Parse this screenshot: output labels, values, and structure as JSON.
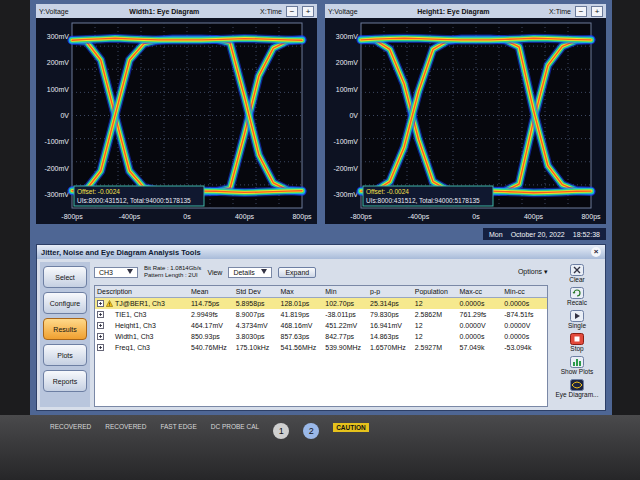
{
  "eye_plots": [
    {
      "title": "Width1: Eye Diagram",
      "y_axis_label": "Y:Voltage",
      "x_axis_label": "X:Time",
      "zoom_out": "−",
      "zoom_in": "+",
      "y_ticks": [
        "300mV",
        "200mV",
        "100mV",
        "0V",
        "-100mV",
        "-200mV",
        "-300mV"
      ],
      "x_ticks": [
        "-800ps",
        "-400ps",
        "0s",
        "400ps",
        "800ps"
      ],
      "offset": "Offset: -0.0024",
      "uis": "UIs:8000:431512, Total:94000:5178135",
      "time_ps": [
        -800,
        -700,
        -600,
        -500,
        -400,
        -300,
        -200,
        -100,
        0,
        100,
        200,
        300,
        400,
        500,
        600,
        700,
        800
      ],
      "traces": [
        [
          285,
          280,
          210,
          0,
          -210,
          -272,
          -285,
          -290,
          -290,
          -290,
          -288,
          -275,
          -70,
          150,
          255,
          282,
          288
        ],
        [
          -285,
          -280,
          -210,
          0,
          210,
          272,
          285,
          290,
          290,
          290,
          288,
          275,
          70,
          -150,
          -255,
          -282,
          -288
        ],
        [
          285,
          288,
          290,
          292,
          290,
          288,
          286,
          286,
          286,
          286,
          287,
          289,
          291,
          290,
          288,
          286,
          285
        ],
        [
          -285,
          -288,
          -290,
          -292,
          -290,
          -288,
          -286,
          -286,
          -286,
          -286,
          -287,
          -289,
          -291,
          -290,
          -288,
          -286,
          -285
        ]
      ]
    },
    {
      "title": "Height1: Eye Diagram",
      "y_axis_label": "Y:Voltage",
      "x_axis_label": "X:Time",
      "zoom_out": "−",
      "zoom_in": "+",
      "y_ticks": [
        "300mV",
        "200mV",
        "100mV",
        "0V",
        "-100mV",
        "-200mV",
        "-300mV"
      ],
      "x_ticks": [
        "-800ps",
        "-400ps",
        "0s",
        "400ps",
        "800ps"
      ],
      "offset": "Offset: -0.0024",
      "uis": "UIs:8000:431512, Total:94000:5178135",
      "time_ps": [
        -800,
        -700,
        -600,
        -500,
        -400,
        -300,
        -200,
        -100,
        0,
        100,
        200,
        300,
        400,
        500,
        600,
        700,
        800
      ],
      "traces": [
        [
          288,
          285,
          250,
          120,
          -90,
          -250,
          -282,
          -290,
          -290,
          -290,
          -286,
          -260,
          -20,
          190,
          262,
          284,
          288
        ],
        [
          -288,
          -285,
          -250,
          -120,
          90,
          250,
          282,
          290,
          290,
          290,
          286,
          260,
          20,
          -190,
          -262,
          -284,
          -288
        ],
        [
          286,
          289,
          291,
          292,
          291,
          289,
          287,
          286,
          286,
          286,
          288,
          290,
          292,
          291,
          289,
          287,
          286
        ],
        [
          -286,
          -289,
          -291,
          -292,
          -291,
          -289,
          -287,
          -286,
          -286,
          -286,
          -288,
          -290,
          -292,
          -291,
          -289,
          -287,
          -286
        ]
      ]
    }
  ],
  "datetime": {
    "day": "Mon",
    "date": "October 20, 2022",
    "time": "18:52:38"
  },
  "panel": {
    "title": "Jitter, Noise and Eye Diagram Analysis Tools",
    "close": "×",
    "options": "Options ▾",
    "nav": [
      {
        "label": "Select",
        "selected": false
      },
      {
        "label": "Configure",
        "selected": false
      },
      {
        "label": "Results",
        "selected": true
      },
      {
        "label": "Plots",
        "selected": false
      },
      {
        "label": "Reports",
        "selected": false
      }
    ],
    "source": "CH3",
    "bit_rate": "Bit Rate : 1.0814Gb/s",
    "pattern_length": "Pattern Length : 2UI",
    "view_label": "View",
    "view": "Details",
    "expand": "Expand",
    "controls": [
      {
        "label": "Clear"
      },
      {
        "label": "Recalc"
      },
      {
        "label": "Single"
      },
      {
        "label": "Stop"
      },
      {
        "label": "Show Plots"
      },
      {
        "label": "Eye Diagram..."
      }
    ]
  },
  "table": {
    "columns": [
      "Description",
      "Mean",
      "Std Dev",
      "Max",
      "Min",
      "p-p",
      "Population",
      "Max-cc",
      "Min-cc"
    ],
    "rows": [
      {
        "selected": true,
        "warning": true,
        "cells": [
          "TJ@BER1, Ch3",
          "114.75ps",
          "5.8958ps",
          "128.01ps",
          "102.70ps",
          "25.314ps",
          "12",
          "0.0000s",
          "0.0000s"
        ]
      },
      {
        "selected": false,
        "warning": false,
        "cells": [
          "TIE1, Ch3",
          "2.9949fs",
          "8.9007ps",
          "41.819ps",
          "-38.011ps",
          "79.830ps",
          "2.5862M",
          "761.29fs",
          "-874.51fs"
        ]
      },
      {
        "selected": false,
        "warning": false,
        "cells": [
          "Height1, Ch3",
          "464.17mV",
          "4.3734mV",
          "468.16mV",
          "451.22mV",
          "16.941mV",
          "12",
          "0.0000V",
          "0.0000V"
        ]
      },
      {
        "selected": false,
        "warning": false,
        "cells": [
          "Width1, Ch3",
          "850.93ps",
          "3.8030ps",
          "857.63ps",
          "842.77ps",
          "14.863ps",
          "12",
          "0.0000s",
          "0.0000s"
        ]
      },
      {
        "selected": false,
        "warning": false,
        "cells": [
          "Freq1, Ch3",
          "540.76MHz",
          "175.10kHz",
          "541.56MHz",
          "539.90MHz",
          "1.6570MHz",
          "2.5927M",
          "57.049k",
          "-53.094k"
        ]
      }
    ]
  },
  "bezel": {
    "labels": [
      "RECOVERED",
      "RECOVERED",
      "FAST EDGE",
      "DC PROBE CAL"
    ],
    "channels": [
      "1",
      "2"
    ],
    "caution": "CAUTION"
  }
}
